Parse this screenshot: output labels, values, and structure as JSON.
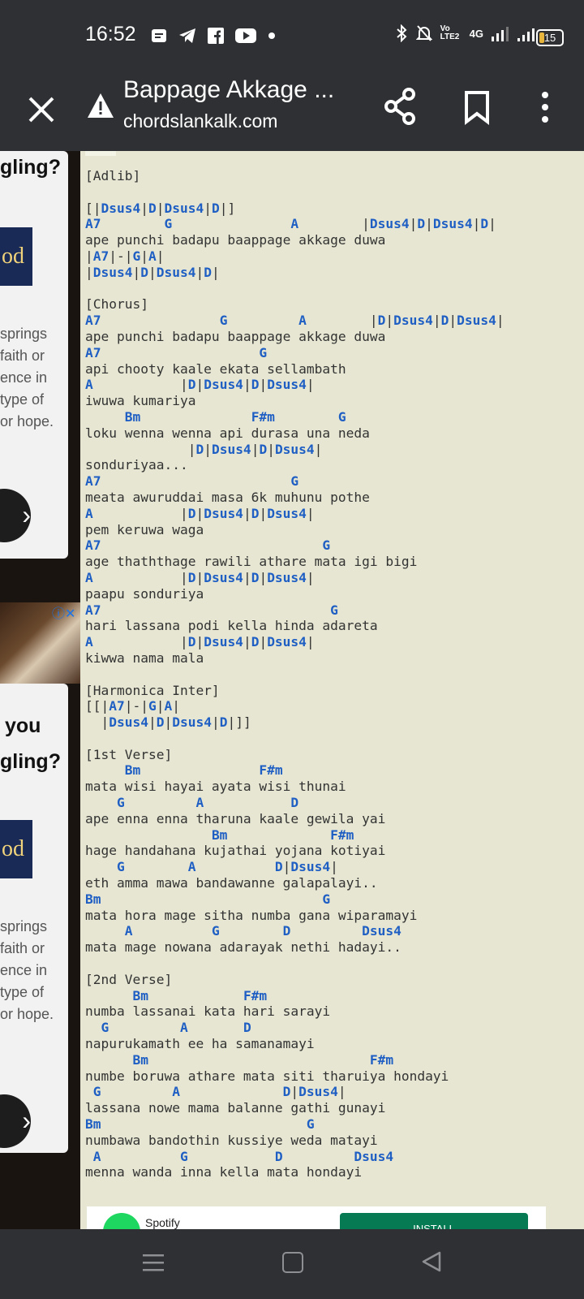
{
  "status_bar": {
    "time": "16:52",
    "network": "4G",
    "volte": "Vo LTE2",
    "battery": "15",
    "battery_color": "#e7b43c"
  },
  "app_bar": {
    "title": "Bappage Akkage ...",
    "url": "chordslankalk.com",
    "icons": [
      "close-icon",
      "warning-icon",
      "share-icon",
      "bookmark-icon",
      "more-vert-icon"
    ]
  },
  "ads": {
    "card1": {
      "heading": "gling?",
      "text": [
        "springs",
        "faith or",
        "ence in",
        "type of",
        "or hope."
      ],
      "logo_text": "od"
    },
    "card2": {
      "heading1": "you",
      "heading2": "gling?",
      "text": [
        "springs",
        "faith or",
        "ence in",
        "type of",
        "or hope."
      ],
      "logo_text": "od"
    },
    "spotify": {
      "name": "Spotify",
      "install": "INSTALL"
    }
  },
  "song_lines": [
    [
      {
        "t": "[Adlib]"
      }
    ],
    [],
    [
      {
        "t": "[|"
      },
      {
        "c": "Dsus4"
      },
      {
        "t": "|"
      },
      {
        "c": "D"
      },
      {
        "t": "|"
      },
      {
        "c": "Dsus4"
      },
      {
        "t": "|"
      },
      {
        "c": "D"
      },
      {
        "t": "|]"
      }
    ],
    [
      {
        "c": "A7"
      },
      {
        "t": "        "
      },
      {
        "c": "G"
      },
      {
        "t": "               "
      },
      {
        "c": "A"
      },
      {
        "t": "        |"
      },
      {
        "c": "Dsus4"
      },
      {
        "t": "|"
      },
      {
        "c": "D"
      },
      {
        "t": "|"
      },
      {
        "c": "Dsus4"
      },
      {
        "t": "|"
      },
      {
        "c": "D"
      },
      {
        "t": "|"
      }
    ],
    [
      {
        "t": "ape punchi badapu baappage akkage duwa"
      }
    ],
    [
      {
        "t": "|"
      },
      {
        "c": "A7"
      },
      {
        "t": "|-|"
      },
      {
        "c": "G"
      },
      {
        "t": "|"
      },
      {
        "c": "A"
      },
      {
        "t": "|"
      }
    ],
    [
      {
        "t": "|"
      },
      {
        "c": "Dsus4"
      },
      {
        "t": "|"
      },
      {
        "c": "D"
      },
      {
        "t": "|"
      },
      {
        "c": "Dsus4"
      },
      {
        "t": "|"
      },
      {
        "c": "D"
      },
      {
        "t": "|"
      }
    ],
    [],
    [
      {
        "t": "[Chorus]"
      }
    ],
    [
      {
        "c": "A7"
      },
      {
        "t": "               "
      },
      {
        "c": "G"
      },
      {
        "t": "         "
      },
      {
        "c": "A"
      },
      {
        "t": "        |"
      },
      {
        "c": "D"
      },
      {
        "t": "|"
      },
      {
        "c": "Dsus4"
      },
      {
        "t": "|"
      },
      {
        "c": "D"
      },
      {
        "t": "|"
      },
      {
        "c": "Dsus4"
      },
      {
        "t": "|"
      }
    ],
    [
      {
        "t": "ape punchi badapu baappage akkage duwa"
      }
    ],
    [
      {
        "c": "A7"
      },
      {
        "t": "                    "
      },
      {
        "c": "G"
      }
    ],
    [
      {
        "t": "api chooty kaale ekata sellambath"
      }
    ],
    [
      {
        "c": "A"
      },
      {
        "t": "           |"
      },
      {
        "c": "D"
      },
      {
        "t": "|"
      },
      {
        "c": "Dsus4"
      },
      {
        "t": "|"
      },
      {
        "c": "D"
      },
      {
        "t": "|"
      },
      {
        "c": "Dsus4"
      },
      {
        "t": "|"
      }
    ],
    [
      {
        "t": "iwuwa kumariya"
      }
    ],
    [
      {
        "t": "     "
      },
      {
        "c": "Bm"
      },
      {
        "t": "              "
      },
      {
        "c": "F#m"
      },
      {
        "t": "        "
      },
      {
        "c": "G"
      }
    ],
    [
      {
        "t": "loku wenna wenna api durasa una neda"
      }
    ],
    [
      {
        "t": "             |"
      },
      {
        "c": "D"
      },
      {
        "t": "|"
      },
      {
        "c": "Dsus4"
      },
      {
        "t": "|"
      },
      {
        "c": "D"
      },
      {
        "t": "|"
      },
      {
        "c": "Dsus4"
      },
      {
        "t": "|"
      }
    ],
    [
      {
        "t": "sonduriyaa..."
      }
    ],
    [
      {
        "c": "A7"
      },
      {
        "t": "                        "
      },
      {
        "c": "G"
      }
    ],
    [
      {
        "t": "meata awuruddai masa 6k muhunu pothe"
      }
    ],
    [
      {
        "c": "A"
      },
      {
        "t": "           |"
      },
      {
        "c": "D"
      },
      {
        "t": "|"
      },
      {
        "c": "Dsus4"
      },
      {
        "t": "|"
      },
      {
        "c": "D"
      },
      {
        "t": "|"
      },
      {
        "c": "Dsus4"
      },
      {
        "t": "|"
      }
    ],
    [
      {
        "t": "pem keruwa waga"
      }
    ],
    [
      {
        "c": "A7"
      },
      {
        "t": "                            "
      },
      {
        "c": "G"
      }
    ],
    [
      {
        "t": "age thaththage rawili athare mata igi bigi"
      }
    ],
    [
      {
        "c": "A"
      },
      {
        "t": "           |"
      },
      {
        "c": "D"
      },
      {
        "t": "|"
      },
      {
        "c": "Dsus4"
      },
      {
        "t": "|"
      },
      {
        "c": "D"
      },
      {
        "t": "|"
      },
      {
        "c": "Dsus4"
      },
      {
        "t": "|"
      }
    ],
    [
      {
        "t": "paapu sonduriya"
      }
    ],
    [
      {
        "c": "A7"
      },
      {
        "t": "                             "
      },
      {
        "c": "G"
      }
    ],
    [
      {
        "t": "hari lassana podi kella hinda adareta"
      }
    ],
    [
      {
        "c": "A"
      },
      {
        "t": "           |"
      },
      {
        "c": "D"
      },
      {
        "t": "|"
      },
      {
        "c": "Dsus4"
      },
      {
        "t": "|"
      },
      {
        "c": "D"
      },
      {
        "t": "|"
      },
      {
        "c": "Dsus4"
      },
      {
        "t": "|"
      }
    ],
    [
      {
        "t": "kiwwa nama mala"
      }
    ],
    [],
    [
      {
        "t": "[Harmonica Inter]"
      }
    ],
    [
      {
        "t": "[[|"
      },
      {
        "c": "A7"
      },
      {
        "t": "|-|"
      },
      {
        "c": "G"
      },
      {
        "t": "|"
      },
      {
        "c": "A"
      },
      {
        "t": "|"
      }
    ],
    [
      {
        "t": "  |"
      },
      {
        "c": "Dsus4"
      },
      {
        "t": "|"
      },
      {
        "c": "D"
      },
      {
        "t": "|"
      },
      {
        "c": "Dsus4"
      },
      {
        "t": "|"
      },
      {
        "c": "D"
      },
      {
        "t": "|]]"
      }
    ],
    [],
    [
      {
        "t": "[1st Verse]"
      }
    ],
    [
      {
        "t": "     "
      },
      {
        "c": "Bm"
      },
      {
        "t": "               "
      },
      {
        "c": "F#m"
      }
    ],
    [
      {
        "t": "mata wisi hayai ayata wisi thunai"
      }
    ],
    [
      {
        "t": "    "
      },
      {
        "c": "G"
      },
      {
        "t": "         "
      },
      {
        "c": "A"
      },
      {
        "t": "           "
      },
      {
        "c": "D"
      }
    ],
    [
      {
        "t": "ape enna enna tharuna kaale gewila yai"
      }
    ],
    [
      {
        "t": "                "
      },
      {
        "c": "Bm"
      },
      {
        "t": "             "
      },
      {
        "c": "F#m"
      }
    ],
    [
      {
        "t": "hage handahana kujathai yojana kotiyai"
      }
    ],
    [
      {
        "t": "    "
      },
      {
        "c": "G"
      },
      {
        "t": "        "
      },
      {
        "c": "A"
      },
      {
        "t": "          "
      },
      {
        "c": "D"
      },
      {
        "t": "|"
      },
      {
        "c": "Dsus4"
      },
      {
        "t": "|"
      }
    ],
    [
      {
        "t": "eth amma mawa bandawanne galapalayi.."
      }
    ],
    [
      {
        "c": "Bm"
      },
      {
        "t": "                            "
      },
      {
        "c": "G"
      }
    ],
    [
      {
        "t": "mata hora mage sitha numba gana wiparamayi"
      }
    ],
    [
      {
        "t": "     "
      },
      {
        "c": "A"
      },
      {
        "t": "          "
      },
      {
        "c": "G"
      },
      {
        "t": "        "
      },
      {
        "c": "D"
      },
      {
        "t": "         "
      },
      {
        "c": "Dsus4"
      }
    ],
    [
      {
        "t": "mata mage nowana adarayak nethi hadayi.."
      }
    ],
    [],
    [
      {
        "t": "[2nd Verse]"
      }
    ],
    [
      {
        "t": "      "
      },
      {
        "c": "Bm"
      },
      {
        "t": "            "
      },
      {
        "c": "F#m"
      }
    ],
    [
      {
        "t": "numba lassanai kata hari sarayi"
      }
    ],
    [
      {
        "t": "  "
      },
      {
        "c": "G"
      },
      {
        "t": "         "
      },
      {
        "c": "A"
      },
      {
        "t": "       "
      },
      {
        "c": "D"
      }
    ],
    [
      {
        "t": "napurukamath ee ha samanamayi"
      }
    ],
    [
      {
        "t": "      "
      },
      {
        "c": "Bm"
      },
      {
        "t": "                            "
      },
      {
        "c": "F#m"
      }
    ],
    [
      {
        "t": "numbe boruwa athare mata siti tharuiya hondayi"
      }
    ],
    [
      {
        "t": " "
      },
      {
        "c": "G"
      },
      {
        "t": "         "
      },
      {
        "c": "A"
      },
      {
        "t": "             "
      },
      {
        "c": "D"
      },
      {
        "t": "|"
      },
      {
        "c": "Dsus4"
      },
      {
        "t": "|"
      }
    ],
    [
      {
        "t": "lassana nowe mama balanne gathi gunayi"
      }
    ],
    [
      {
        "c": "Bm"
      },
      {
        "t": "                          "
      },
      {
        "c": "G"
      }
    ],
    [
      {
        "t": "numbawa bandothin kussiye weda matayi"
      }
    ],
    [
      {
        "t": " "
      },
      {
        "c": "A"
      },
      {
        "t": "          "
      },
      {
        "c": "G"
      },
      {
        "t": "           "
      },
      {
        "c": "D"
      },
      {
        "t": "         "
      },
      {
        "c": "Dsus4"
      }
    ],
    [
      {
        "t": "menna wanda inna kella mata hondayi"
      }
    ]
  ],
  "colors": {
    "chord": "#1f5fc4",
    "lyrics": "#333333",
    "page_bg": "#e6e6d2",
    "bar_bg": "#2e3033"
  },
  "nav_bar": {
    "icons": [
      "recents-icon",
      "home-icon",
      "back-icon"
    ]
  }
}
